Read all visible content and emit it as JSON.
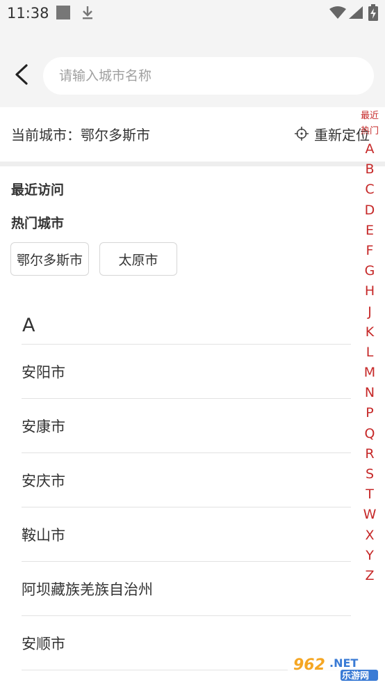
{
  "status_bar": {
    "time": "11:38",
    "icons": [
      "square-notification-icon",
      "download-icon",
      "wifi-icon",
      "signal-icon",
      "battery-charging-icon"
    ]
  },
  "header": {
    "back_icon": "chevron-left-icon",
    "search": {
      "placeholder": "请输入城市名称",
      "value": ""
    }
  },
  "current_city": {
    "label": "当前城市：鄂尔多斯市",
    "relocate_label": "重新定位",
    "relocate_icon": "crosshair-icon"
  },
  "sections": {
    "recent_title": "最近访问",
    "hot_title": "热门城市",
    "hot_cities": [
      "鄂尔多斯市",
      "太原市"
    ]
  },
  "city_list": {
    "letter": "A",
    "cities": [
      "安阳市",
      "安康市",
      "安庆市",
      "鞍山市",
      "阿坝藏族羌族自治州",
      "安顺市"
    ]
  },
  "index_bar": {
    "top_labels": [
      "最近",
      "热门"
    ],
    "letters": [
      "A",
      "B",
      "C",
      "D",
      "E",
      "F",
      "G",
      "H",
      "J",
      "K",
      "L",
      "M",
      "N",
      "P",
      "Q",
      "R",
      "S",
      "T",
      "W",
      "X",
      "Y",
      "Z"
    ],
    "color": "#c62828"
  },
  "watermark": {
    "text": "962.NET",
    "subtext": "乐游网"
  },
  "colors": {
    "accent": "#c62828",
    "header_bg": "#f4f4f4",
    "divider": "#e2e2e2"
  }
}
